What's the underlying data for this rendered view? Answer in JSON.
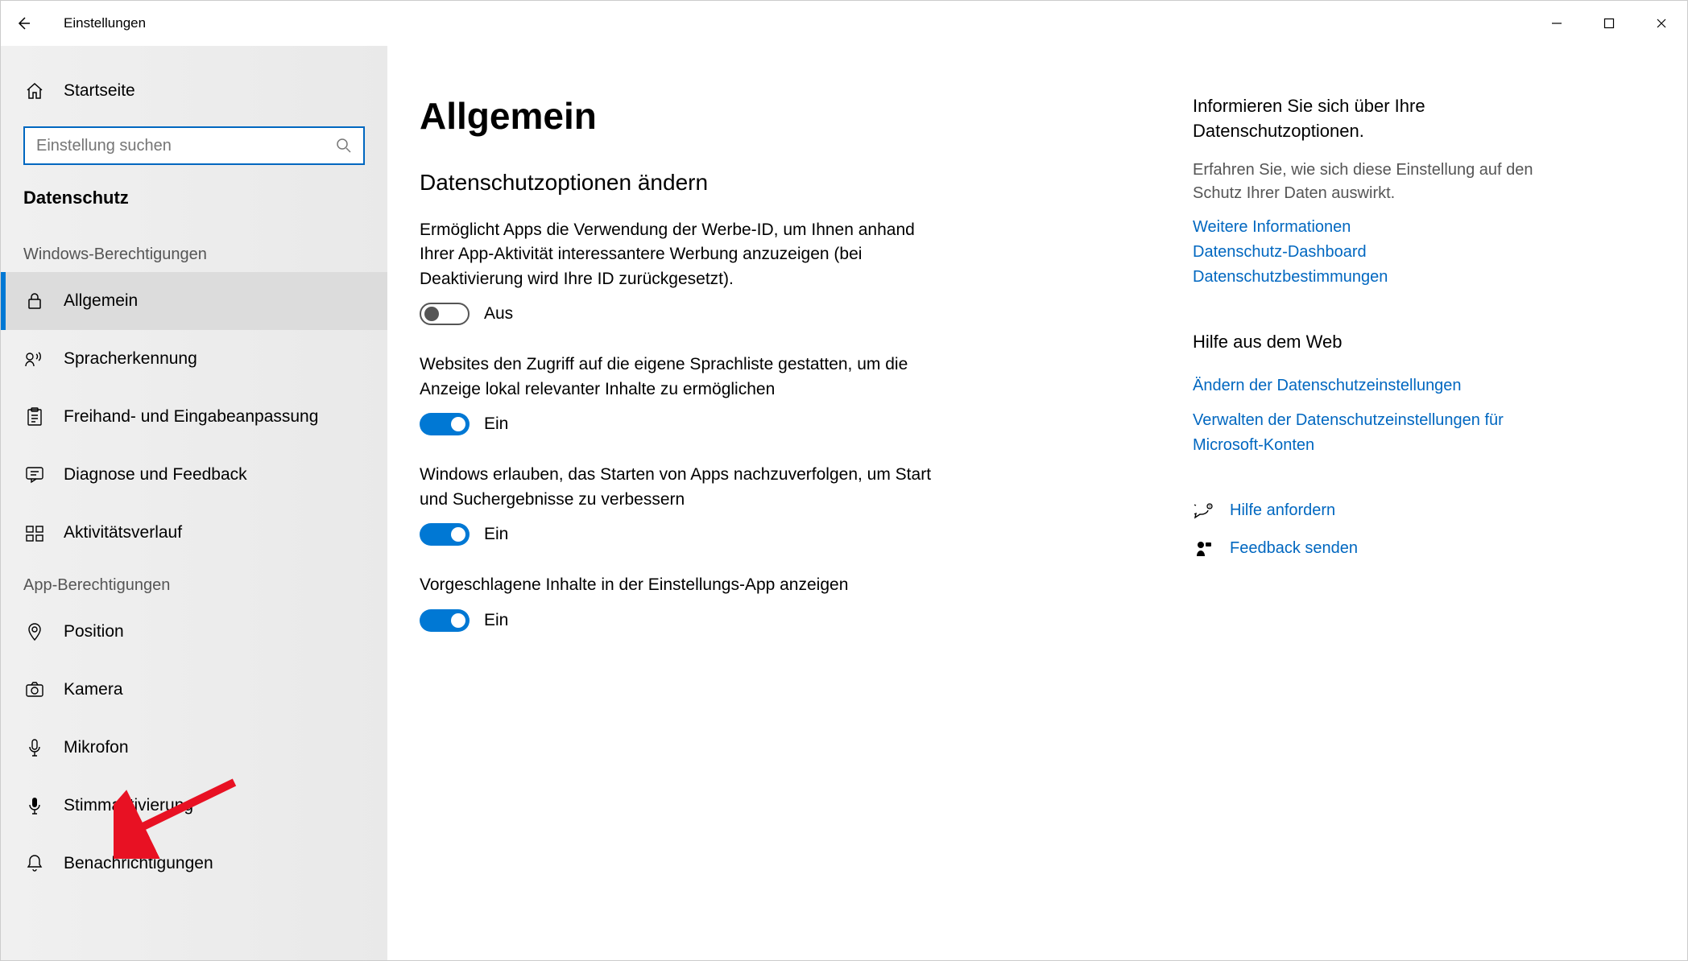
{
  "titlebar": {
    "title": "Einstellungen"
  },
  "sidebar": {
    "home": "Startseite",
    "search_placeholder": "Einstellung suchen",
    "category": "Datenschutz",
    "section1_title": "Windows-Berechtigungen",
    "section1": [
      {
        "label": "Allgemein",
        "icon": "lock",
        "active": true
      },
      {
        "label": "Spracherkennung",
        "icon": "speech"
      },
      {
        "label": "Freihand- und Eingabeanpassung",
        "icon": "clipboard"
      },
      {
        "label": "Diagnose und Feedback",
        "icon": "feedback"
      },
      {
        "label": "Aktivitätsverlauf",
        "icon": "history"
      }
    ],
    "section2_title": "App-Berechtigungen",
    "section2": [
      {
        "label": "Position",
        "icon": "location"
      },
      {
        "label": "Kamera",
        "icon": "camera"
      },
      {
        "label": "Mikrofon",
        "icon": "mic"
      },
      {
        "label": "Stimmaktivierung",
        "icon": "voice"
      },
      {
        "label": "Benachrichtigungen",
        "icon": "bell"
      }
    ]
  },
  "main": {
    "heading": "Allgemein",
    "subheading": "Datenschutzoptionen ändern",
    "settings": [
      {
        "desc": "Ermöglicht Apps die Verwendung der Werbe-ID, um Ihnen anhand Ihrer App-Aktivität interessantere Werbung anzuzeigen (bei Deaktivierung wird Ihre ID zurückgesetzt).",
        "on": false,
        "label": "Aus"
      },
      {
        "desc": "Websites den Zugriff auf die eigene Sprachliste gestatten, um die Anzeige lokal relevanter Inhalte zu ermöglichen",
        "on": true,
        "label": "Ein"
      },
      {
        "desc": "Windows erlauben, das Starten von Apps nachzuverfolgen, um Start und Suchergebnisse zu verbessern",
        "on": true,
        "label": "Ein"
      },
      {
        "desc": "Vorgeschlagene Inhalte in der Einstellungs-App anzeigen",
        "on": true,
        "label": "Ein"
      }
    ]
  },
  "aside": {
    "info_heading": "Informieren Sie sich über Ihre Datenschutzoptionen.",
    "info_note": "Erfahren Sie, wie sich diese Einstellung auf den Schutz Ihrer Daten auswirkt.",
    "info_links": [
      "Weitere Informationen",
      "Datenschutz-Dashboard",
      "Datenschutzbestimmungen"
    ],
    "webhelp_heading": "Hilfe aus dem Web",
    "webhelp_links": [
      "Ändern der Datenschutzeinstellungen",
      "Verwalten der Datenschutzeinstellungen für Microsoft-Konten"
    ],
    "support": [
      {
        "label": "Hilfe anfordern",
        "icon": "help"
      },
      {
        "label": "Feedback senden",
        "icon": "feedback-small"
      }
    ]
  }
}
